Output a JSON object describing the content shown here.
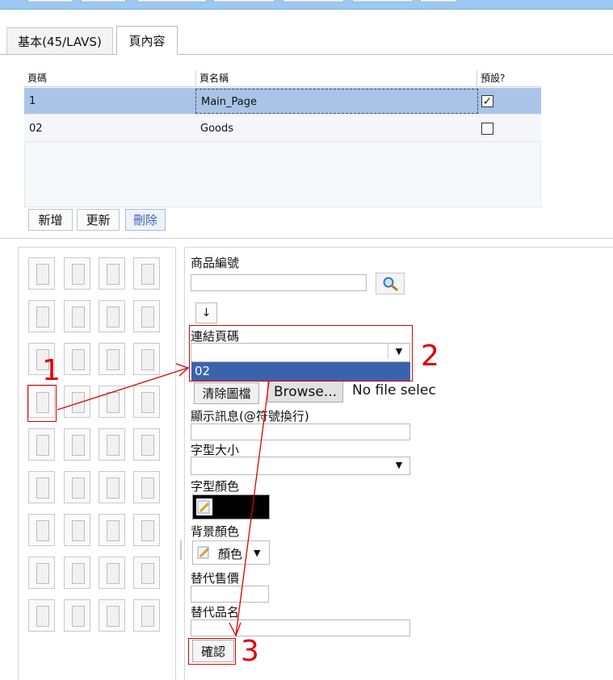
{
  "tabs": [
    {
      "label": "基本(45/LAVS)"
    },
    {
      "label": "頁內容"
    }
  ],
  "grid": {
    "columns": [
      "頁碼",
      "頁名稱",
      "預設?"
    ],
    "rows": [
      {
        "page_no": "1",
        "page_name": "Main_Page",
        "default": true,
        "selected": true
      },
      {
        "page_no": "02",
        "page_name": "Goods",
        "default": false,
        "selected": false
      }
    ],
    "buttons": {
      "add": "新增",
      "update": "更新",
      "delete": "刪除"
    }
  },
  "form": {
    "product_no_label": "商品編號",
    "product_no_value": "",
    "arrow_down": "↓",
    "link_page_label": "連結頁碼",
    "link_page_value": "",
    "link_page_option": "02",
    "clear_image_label": "清除圖檔",
    "browse_label": "Browse...",
    "file_status": "No file selec",
    "display_msg_label": "顯示訊息(@符號換行)",
    "font_size_label": "字型大小",
    "font_color_label": "字型顏色",
    "bg_color_label": "背景顏色",
    "bg_color_value": "顏色",
    "alt_price_label": "替代售價",
    "alt_name_label": "替代品名",
    "confirm_label": "確認"
  },
  "annotations": [
    "1",
    "2",
    "3"
  ],
  "colors": {
    "selected_row": "#a9c4e6",
    "dropdown_highlight": "#3b63ad",
    "annotation": "#e00000",
    "top_bar": "#9cc9f2"
  }
}
